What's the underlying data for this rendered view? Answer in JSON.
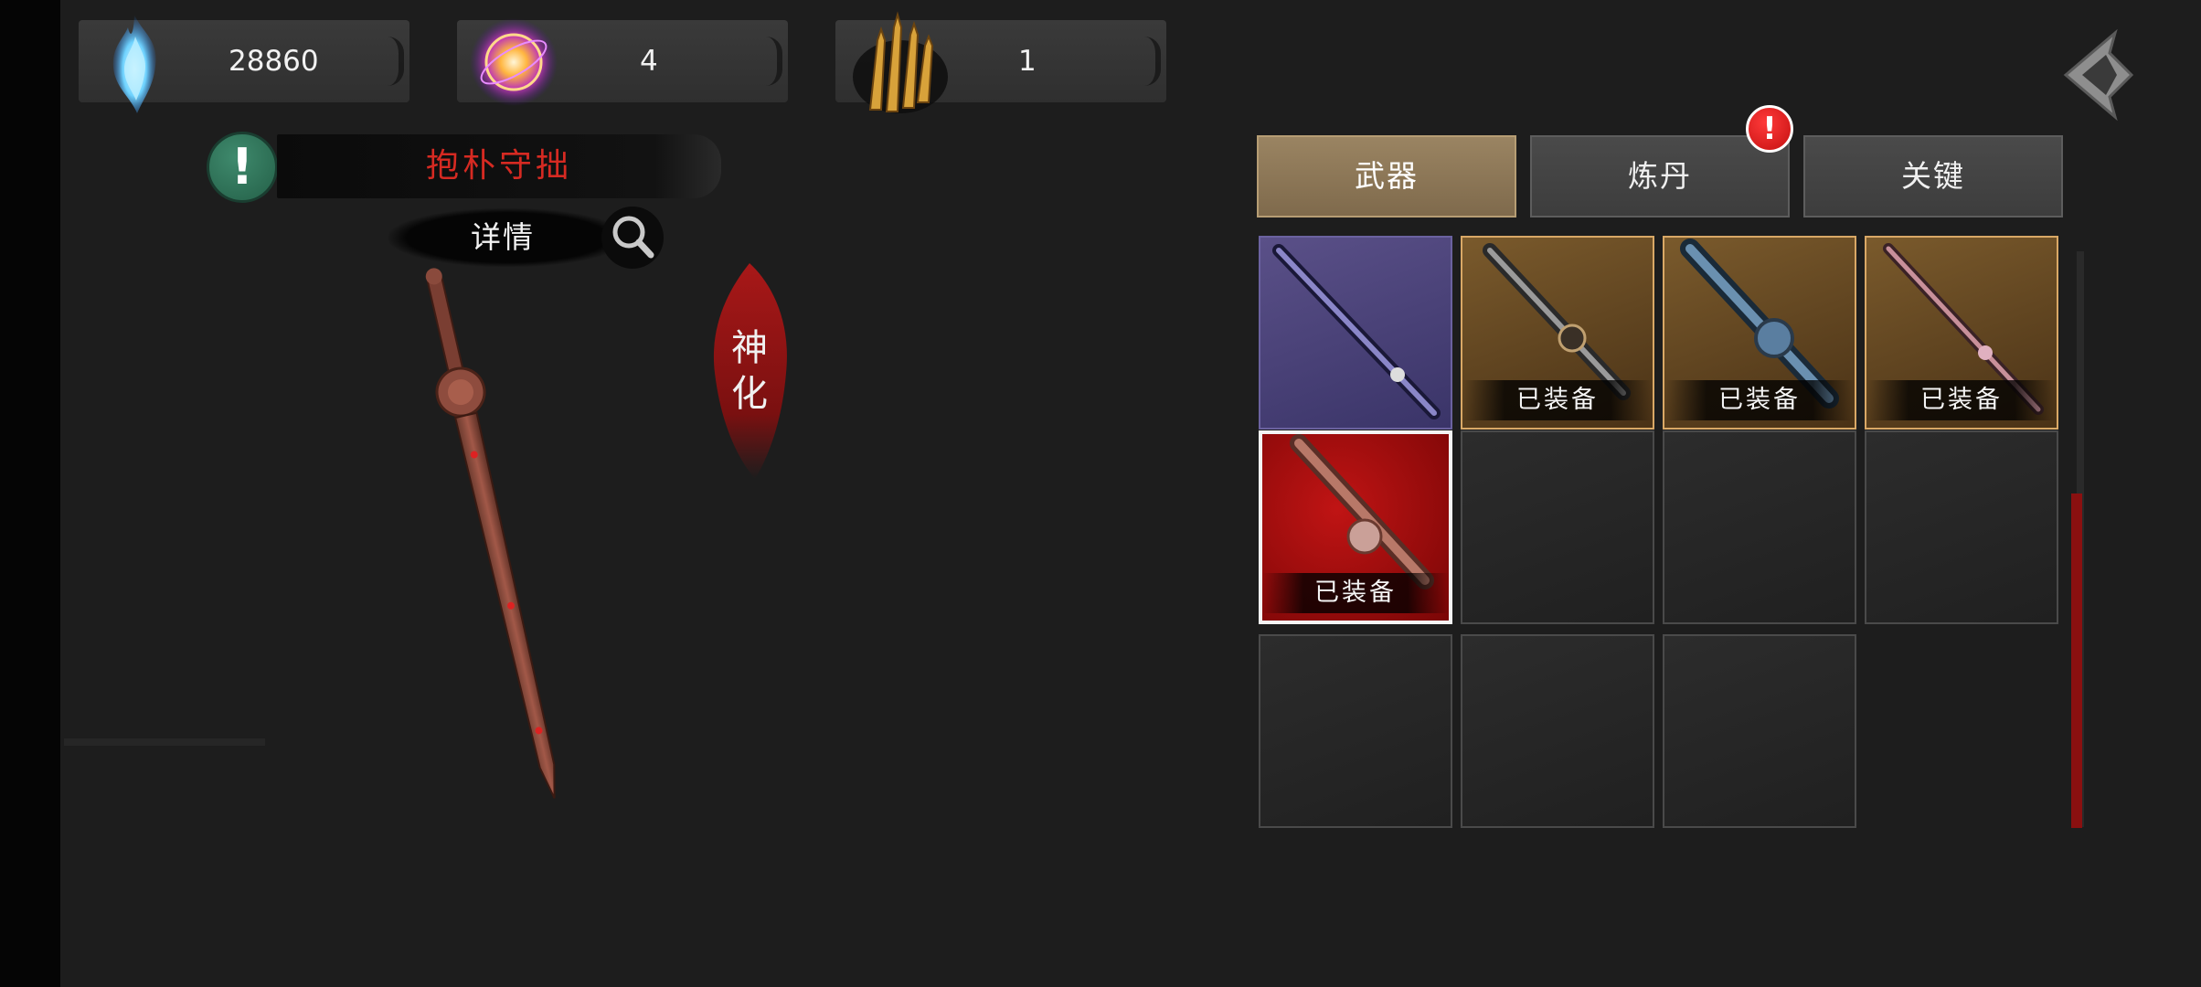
{
  "currencies": [
    {
      "icon": "blue-flame-icon",
      "value": "28860"
    },
    {
      "icon": "spirit-orb-icon",
      "value": "4"
    },
    {
      "icon": "golden-blades-icon",
      "value": "1"
    }
  ],
  "weapon": {
    "name": "抱朴守拙",
    "detail_label": "详情",
    "tier_label": "神化"
  },
  "tabs": [
    {
      "label": "武器",
      "active": true
    },
    {
      "label": "炼丹",
      "active": false,
      "alert": true
    },
    {
      "label": "关键",
      "active": false
    }
  ],
  "inventory": {
    "equipped_label": "已装备",
    "slots": [
      {
        "rarity": "purple",
        "equipped": false
      },
      {
        "rarity": "gold",
        "equipped": true
      },
      {
        "rarity": "gold",
        "equipped": true
      },
      {
        "rarity": "gold",
        "equipped": true
      },
      {
        "rarity": "red",
        "equipped": true,
        "selected": true
      },
      {
        "rarity": "empty"
      },
      {
        "rarity": "empty"
      },
      {
        "rarity": "empty"
      },
      {
        "rarity": "empty"
      },
      {
        "rarity": "empty"
      },
      {
        "rarity": "empty"
      }
    ]
  },
  "colors": {
    "accent_red": "#d62a22",
    "gold_frame": "#d9a866",
    "purple_frame": "#6b62a0",
    "alert_green": "#2f7a5c"
  }
}
